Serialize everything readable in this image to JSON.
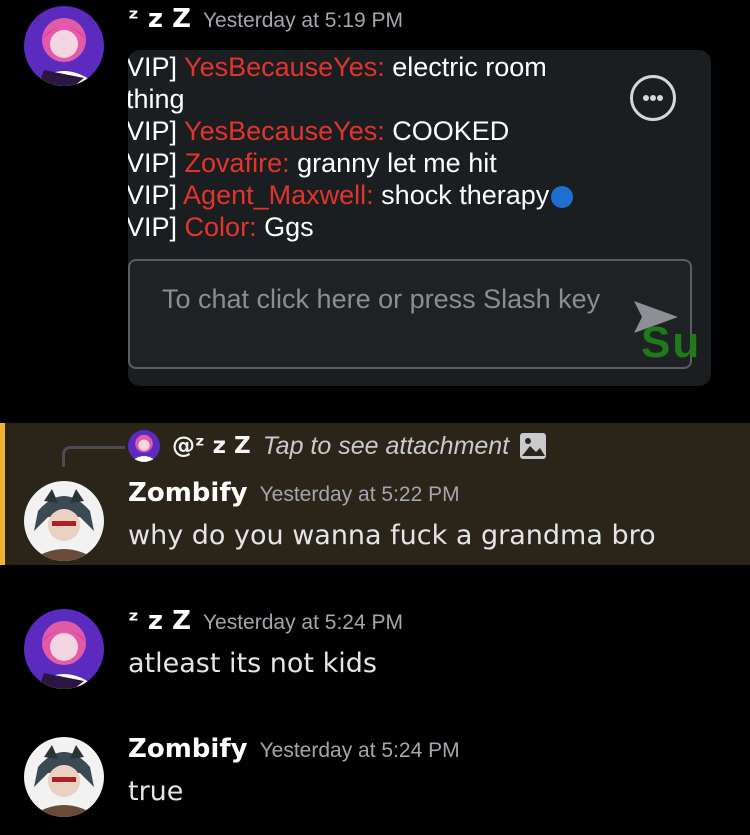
{
  "messages": [
    {
      "author": "ᶻ z Z",
      "timestamp": "Yesterday at 5:19 PM",
      "attachment": {
        "chat_lines": [
          {
            "prefix": "VIP]",
            "player": "YesBecauseYes:",
            "text": "electric room"
          },
          {
            "prefix": "",
            "player": "",
            "text": "thing"
          },
          {
            "prefix": "VIP]",
            "player": "YesBecauseYes:",
            "text": "COOKED"
          },
          {
            "prefix": "VIP]",
            "player": "Zovafire:",
            "text": "granny let me hit"
          },
          {
            "prefix": "VIP]",
            "player": "Agent_Maxwell:",
            "text": "shock therapy"
          },
          {
            "prefix": "VIP]",
            "player": "Color:",
            "text": "Ggs"
          }
        ],
        "input_placeholder": "To chat click here or press Slash key",
        "partial_text": "Su"
      }
    },
    {
      "author": "Zombify",
      "timestamp": "Yesterday at 5:22 PM",
      "text": "why do you wanna fuck a grandma bro",
      "reply": {
        "mention": "@ᶻ z Z",
        "attachment_text": "Tap to see attachment"
      }
    },
    {
      "author": "ᶻ z Z",
      "timestamp": "Yesterday at 5:24 PM",
      "text": "atleast its not kids"
    },
    {
      "author": "Zombify",
      "timestamp": "Yesterday at 5:24 PM",
      "text": "true"
    }
  ],
  "colors": {
    "background": "#000000",
    "mention_highlight": "#2a2518",
    "mention_bar": "#f0b232",
    "player_name": "#e3342c",
    "timestamp": "#a3a6ad"
  },
  "icons": [
    "more-options-icon",
    "send-arrow-icon",
    "image-icon"
  ]
}
